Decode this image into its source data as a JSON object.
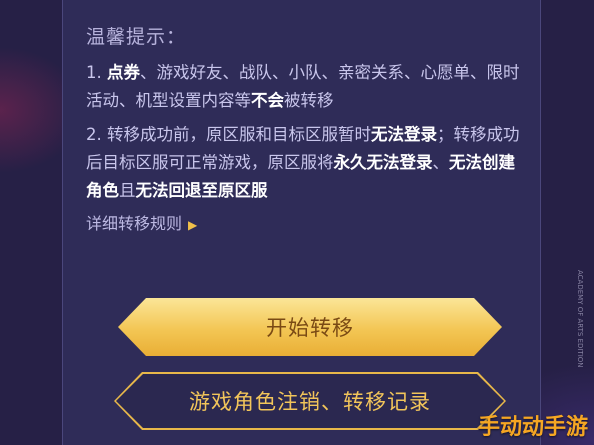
{
  "notice": {
    "heading": "温馨提示：",
    "item1": {
      "prefix": "1. ",
      "em1": "点券",
      "text1": "、游戏好友、战队、小队、亲密关系、心愿单、限时活动、机型设置内容等",
      "em2": "不会",
      "text2": "被转移"
    },
    "item2": {
      "text1": "2. 转移成功前，原区服和目标区服暂时",
      "em1": "无法登录",
      "text2": "；转移成功后目标区服可正常游戏，原区服将",
      "em2": "永久无法登录",
      "text3": "、",
      "em3": "无法创建角色",
      "text4": "且",
      "em4": "无法回退至原区服"
    }
  },
  "rules_link": {
    "label": "详细转移规则",
    "arrow": "▶"
  },
  "buttons": {
    "start_transfer": "开始转移",
    "records": "游戏角色注销、转移记录"
  },
  "watermark": {
    "text": "手动动手游",
    "side_text": "ACADEMY OF ARTS EDITION"
  },
  "colors": {
    "accent": "#f3c654",
    "background": "#2f2c58",
    "emphasis": "#ffffff"
  }
}
